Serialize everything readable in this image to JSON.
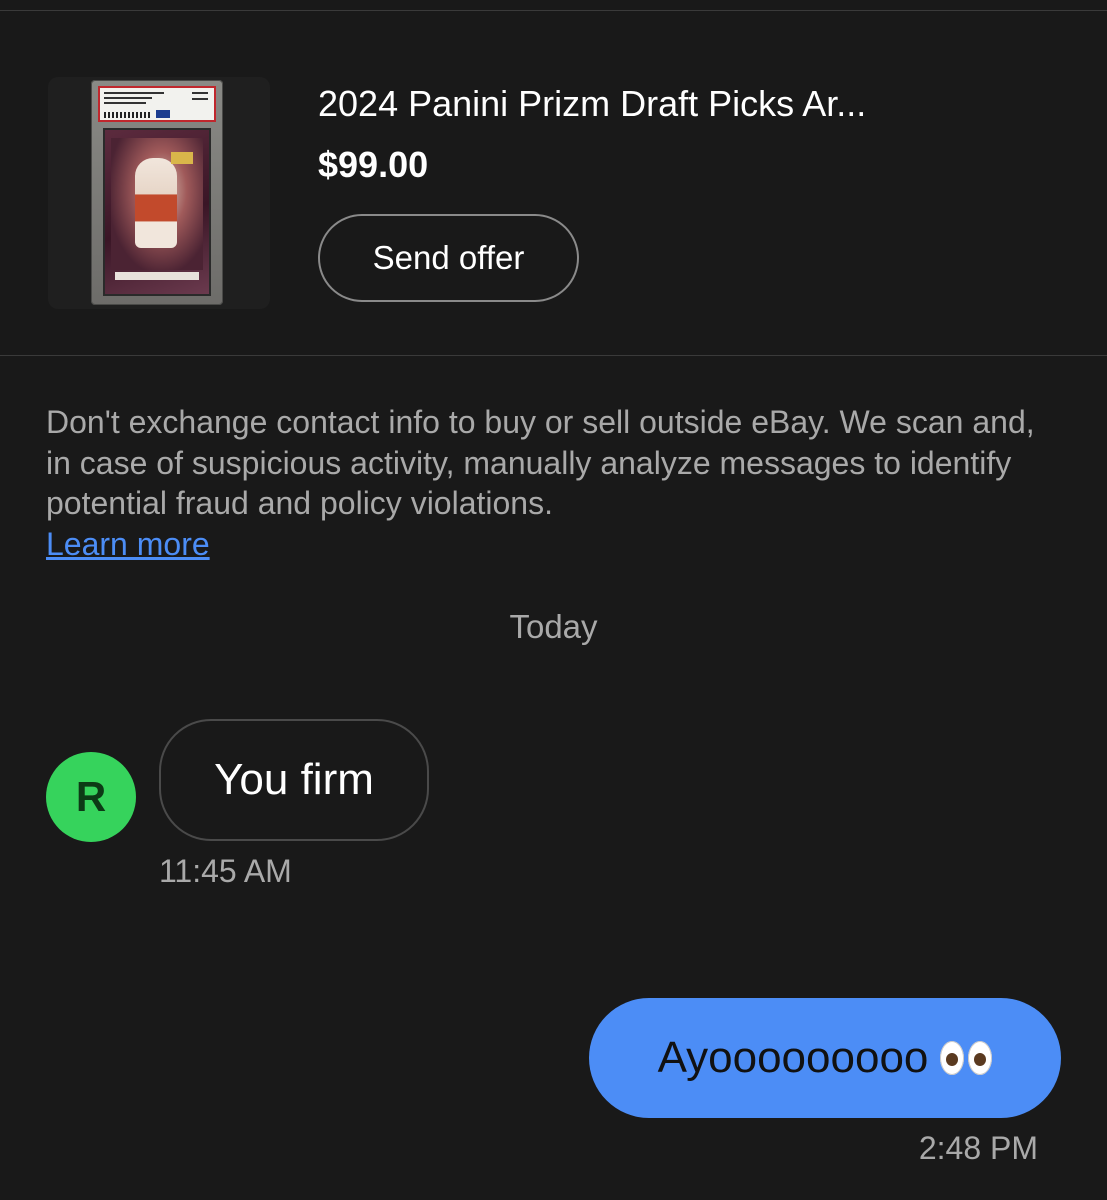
{
  "listing": {
    "title": "2024 Panini Prizm Draft Picks Ar...",
    "price": "$99.00",
    "send_offer_label": "Send offer",
    "thumbnail_icon": "graded-card-image"
  },
  "notice": {
    "text": "Don't exchange contact info to buy or sell outside eBay. We scan and, in case of suspicious activity, manually analyze messages to identify potential fraud and policy violations.",
    "link_label": "Learn more",
    "link_color": "#4c8df6"
  },
  "conversation": {
    "date_separator": "Today",
    "messages": [
      {
        "direction": "incoming",
        "avatar_initial": "R",
        "avatar_color": "#36d35c",
        "text": "You firm",
        "time": "11:45 AM"
      },
      {
        "direction": "outgoing",
        "text": "Ayooooooooo",
        "emoji": "eyes-emoji",
        "bubble_color": "#4c8df6",
        "time": "2:48 PM"
      }
    ]
  },
  "colors": {
    "background": "#191919",
    "divider": "#3a3a3a",
    "muted_text": "#a9a9a9"
  }
}
